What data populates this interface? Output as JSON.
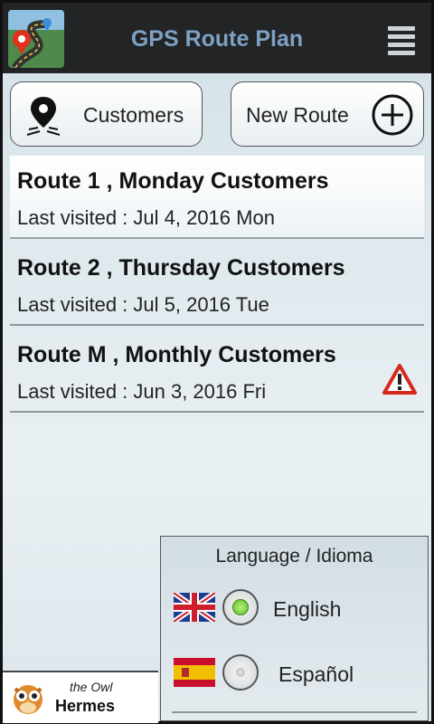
{
  "app": {
    "title": "GPS Route Plan"
  },
  "toolbar": {
    "customers_label": "Customers",
    "new_route_label": "New Route"
  },
  "routes": [
    {
      "name": "Route 1 , Monday Customers",
      "last_visited": "Last visited : Jul 4, 2016 Mon",
      "warning": false
    },
    {
      "name": "Route 2 , Thursday Customers",
      "last_visited": "Last visited : Jul 5, 2016 Tue",
      "warning": false
    },
    {
      "name": "Route M , Monthly Customers",
      "last_visited": "Last visited : Jun 3, 2016 Fri",
      "warning": true
    }
  ],
  "branding": {
    "line1": "the Owl",
    "line2": "Hermes"
  },
  "language": {
    "title": "Language / Idioma",
    "options": [
      {
        "label": "English",
        "selected": true
      },
      {
        "label": "Español",
        "selected": false
      }
    ]
  },
  "colors": {
    "title": "#7ea1c3",
    "topbar": "#222426",
    "selected_radio": "#5bbd2a",
    "warning": "#d42a1c"
  }
}
